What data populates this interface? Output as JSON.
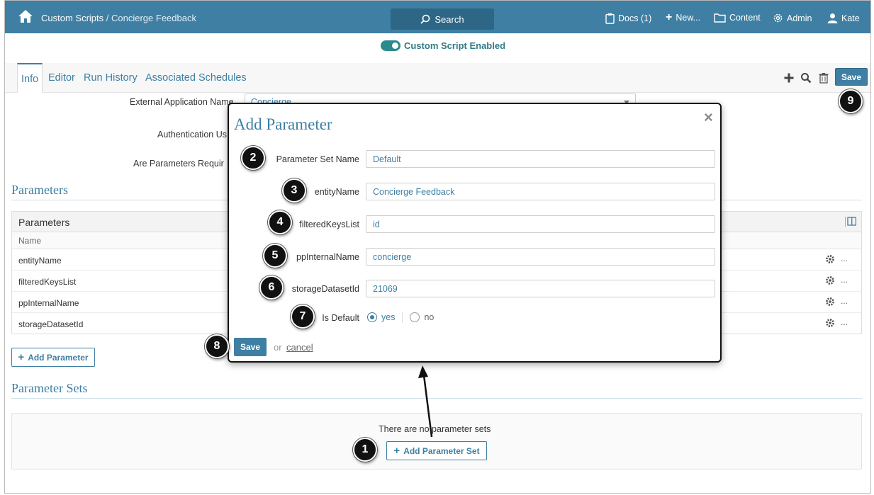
{
  "header": {
    "breadcrumb_parent": "Custom Scripts",
    "breadcrumb_sep": "/",
    "breadcrumb_current": "Concierge Feedback",
    "search_label": "Search",
    "docs_label": "Docs (1)",
    "new_label": "New...",
    "content_label": "Content",
    "admin_label": "Admin",
    "user_label": "Kate",
    "bar_color": "#3e7fa3"
  },
  "toggle": {
    "label": "Custom Script Enabled",
    "enabled": true
  },
  "tabs": [
    {
      "label": "Info",
      "active": true
    },
    {
      "label": "Editor",
      "active": false
    },
    {
      "label": "Run History",
      "active": false
    },
    {
      "label": "Associated Schedules",
      "active": false
    }
  ],
  "toolbar": {
    "save_label": "Save"
  },
  "form": {
    "external_app_label": "External Application Name",
    "external_app_value": "Concierge",
    "auth_label": "Authentication Us",
    "params_required_label": "Are Parameters Requir"
  },
  "parameters": {
    "section_title": "Parameters",
    "table_title": "Parameters",
    "column_name": "Name",
    "rows": [
      "entityName",
      "filteredKeysList",
      "ppInternalName",
      "storageDatasetId"
    ],
    "row_more": "...",
    "add_label": "Add Parameter"
  },
  "parameter_sets": {
    "section_title": "Parameter Sets",
    "empty_text": "There are no parameter sets",
    "add_label": "Add Parameter Set"
  },
  "modal": {
    "title": "Add Parameter",
    "close": "×",
    "fields": {
      "set_name_label": "Parameter Set Name",
      "set_name_value": "Default",
      "entity_label": "entityName",
      "entity_value": "Concierge Feedback",
      "keys_label": "filteredKeysList",
      "keys_value": "id",
      "pp_label": "ppInternalName",
      "pp_value": "concierge",
      "storage_label": "storageDatasetId",
      "storage_value": "21069"
    },
    "is_default_label": "Is Default",
    "yes_label": "yes",
    "no_label": "no",
    "default_selected": "yes",
    "save_label": "Save",
    "or_label": "or",
    "cancel_label": "cancel"
  },
  "callouts": [
    "1",
    "2",
    "3",
    "4",
    "5",
    "6",
    "7",
    "8",
    "9"
  ]
}
